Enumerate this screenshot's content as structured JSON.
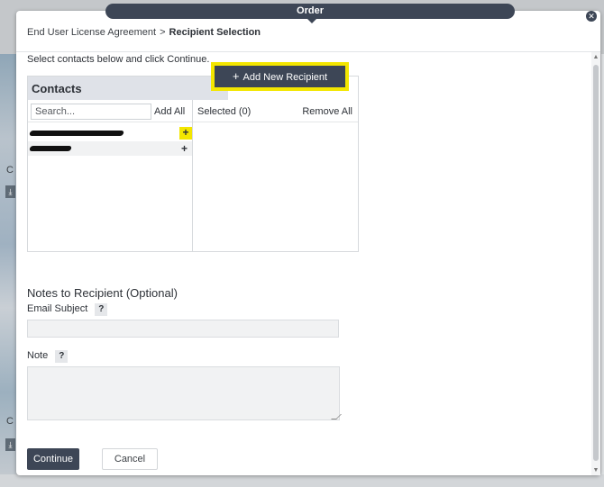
{
  "window": {
    "tab_title": "Order",
    "close_symbol": "✕"
  },
  "breadcrumb": {
    "parent": "End User License Agreement",
    "separator": ">",
    "current": "Recipient Selection"
  },
  "instructions": "Select contacts below and click Continue.",
  "contacts": {
    "title": "Contacts",
    "add_new_label": "Add New Recipient",
    "add_new_icon": "plus-icon",
    "search_placeholder": "Search...",
    "add_all_label": "Add All",
    "selected_label": "Selected (0)",
    "remove_all_label": "Remove All",
    "row_add_symbol": "+"
  },
  "notes": {
    "title": "Notes to Recipient (Optional)",
    "subject_label": "Email Subject",
    "note_label": "Note",
    "help_symbol": "?"
  },
  "actions": {
    "continue_label": "Continue",
    "cancel_label": "Cancel"
  },
  "colors": {
    "primary": "#3d4656",
    "highlight": "#f3e600",
    "panel_header": "#dfe2e8"
  }
}
